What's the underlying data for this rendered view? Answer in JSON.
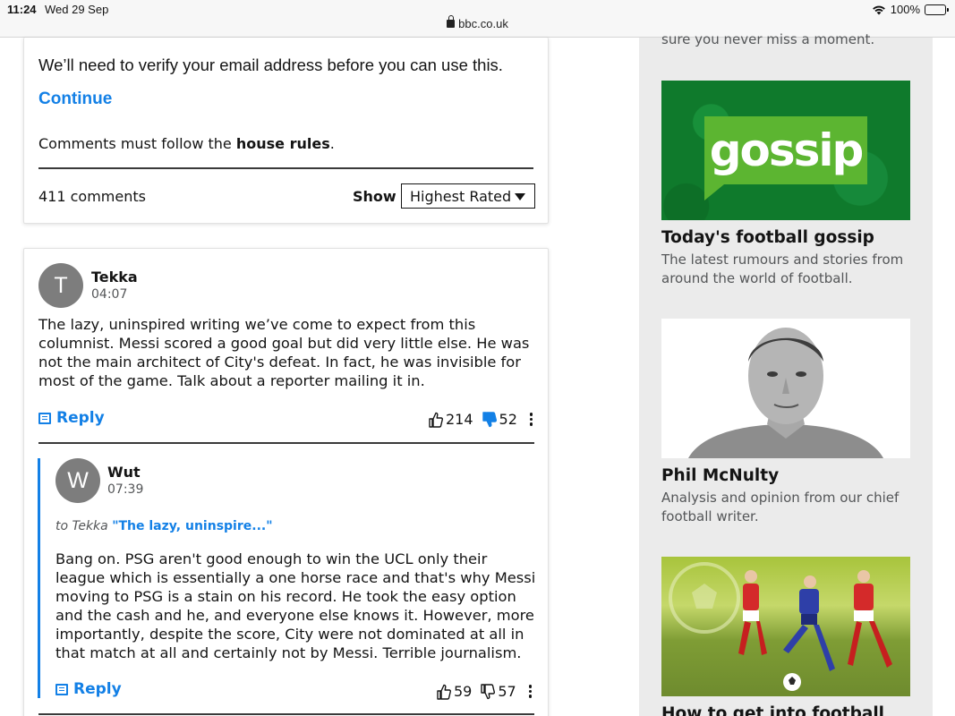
{
  "status_bar": {
    "time": "11:24",
    "date": "Wed 29 Sep",
    "url": "bbc.co.uk",
    "battery": "100%"
  },
  "verify": {
    "message": "We’ll need to verify your email address before you can use this.",
    "continue_label": "Continue",
    "rules_prefix": "Comments must follow the ",
    "rules_link": "house rules",
    "rules_suffix": "."
  },
  "comments_header": {
    "count": "411 comments",
    "show_label": "Show",
    "sort_selected": "Highest Rated"
  },
  "comments": [
    {
      "initial": "T",
      "author": "Tekka",
      "time": "04:07",
      "body": "The lazy, uninspired writing we’ve come to expect from this columnist. Messi scored a good goal but did very little else. He was not the main architect of City's defeat. In fact, he was invisible for most of the game. Talk about a reporter mailing it in.",
      "reply_label": "Reply",
      "upvotes": "214",
      "downvotes": "52"
    },
    {
      "initial": "W",
      "author": "Wut",
      "time": "07:39",
      "reply_to_prefix": "to Tekka",
      "reply_to_quote": "\"The lazy, uninspire...\"",
      "body": "Bang on. PSG aren't good enough to win the UCL only their league which is essentially a one horse race and that's why Messi moving to PSG is a stain on his record. He took the easy option and the cash and he, and everyone else knows it. However, more importantly, despite the score, City were not dominated at all in that match at all and certainly not by Messi. Terrible journalism.",
      "reply_label": "Reply",
      "upvotes": "59",
      "downvotes": "57"
    }
  ],
  "sidebar": {
    "cut_text": "sure you never miss a moment.",
    "promos": [
      {
        "image_text": "gossip",
        "title": "Today's football gossip",
        "desc": "The latest rumours and stories from around the world of football."
      },
      {
        "title": "Phil McNulty",
        "desc": "Analysis and opinion from our chief football writer."
      },
      {
        "title": "How to get into football"
      }
    ]
  },
  "colors": {
    "link_blue": "#1380e6",
    "gossip_green": "#0f7a2c",
    "gossip_bubble": "#5cb531",
    "sidebar_bg": "#ebebeb"
  }
}
